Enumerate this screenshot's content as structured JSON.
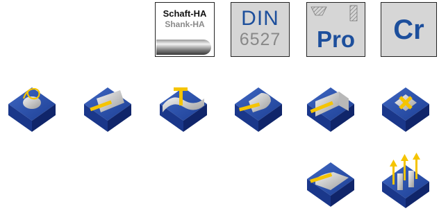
{
  "badges": {
    "shank": {
      "line1": "Schaft-HA",
      "line2": "Shank-HA",
      "icon": "shank-icon"
    },
    "din": {
      "line1": "DIN",
      "line2": "6527"
    },
    "pro": {
      "label": "Pro",
      "icon": "pro-tool-icons"
    },
    "cr": {
      "label": "Cr"
    }
  },
  "operations_row1": [
    "helical-plunge-icon",
    "slot-milling-icon",
    "profile-milling-icon",
    "pocket-milling-icon",
    "shoulder-milling-icon",
    "cross-pocket-icon"
  ],
  "operations_row2": [
    "side-milling-icon",
    "plunge-drilling-icon"
  ],
  "colors": {
    "block_blue": "#1d3f95",
    "block_dark": "#10256a",
    "tool_yellow": "#f5c400",
    "badge_grey": "#d6d6d6",
    "text_blue": "#1d4f9c"
  }
}
